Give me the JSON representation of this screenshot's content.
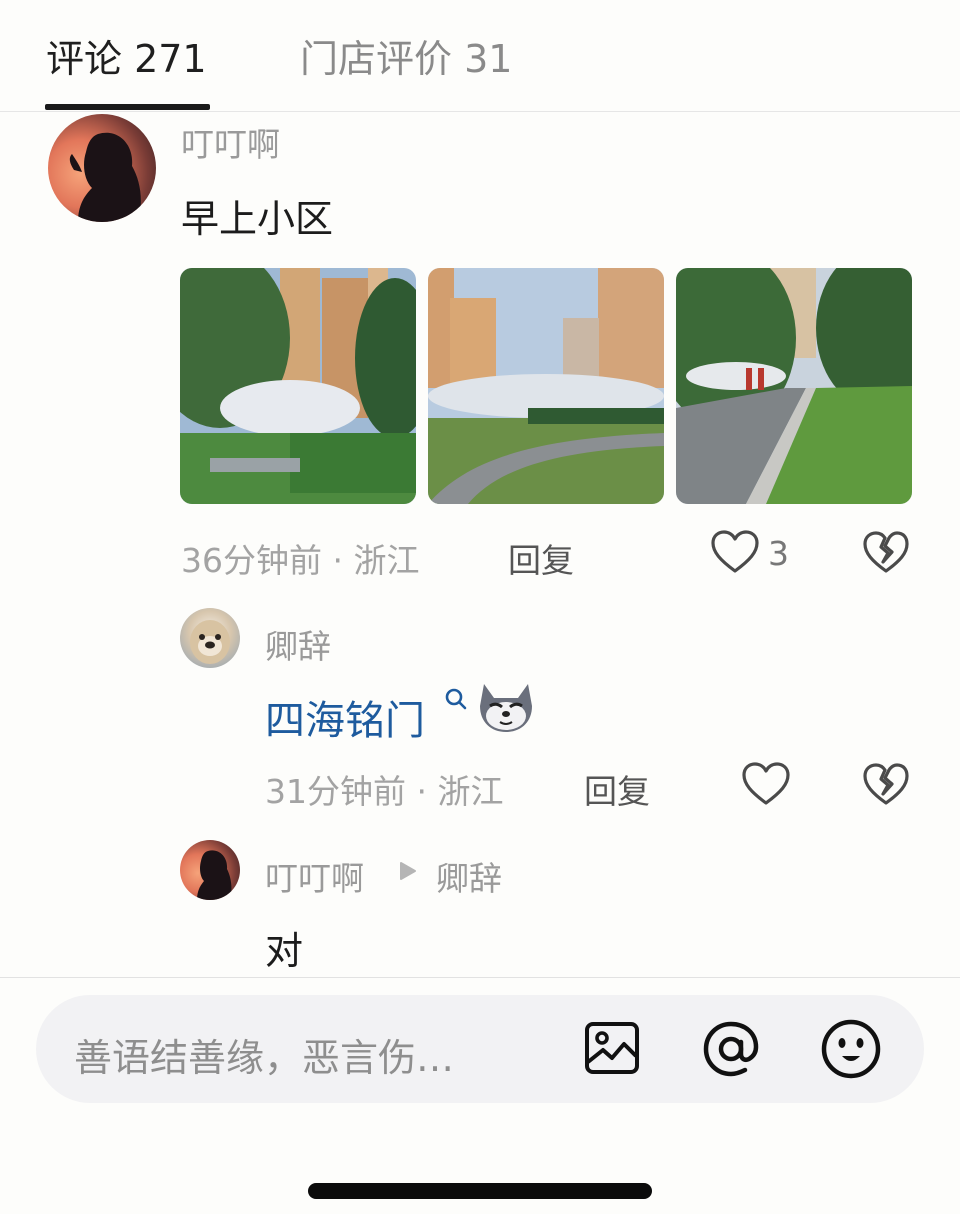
{
  "tabs": [
    {
      "label": "评论 271",
      "active": true
    },
    {
      "label": "门店评价 31",
      "active": false
    }
  ],
  "comment": {
    "username": "叮叮啊",
    "text": "早上小区",
    "time_location": "36分钟前 · 浙江",
    "reply_label": "回复",
    "like_count": "3",
    "photo_count": 3
  },
  "replies": [
    {
      "username": "卿辞",
      "text": "四海铭门",
      "time_location": "31分钟前 · 浙江",
      "reply_label": "回复"
    },
    {
      "username": "叮叮啊",
      "reply_to": "卿辞",
      "text": "对"
    }
  ],
  "input": {
    "placeholder": "善语结善缘，恶言伤…"
  },
  "icons": {
    "like": "heart-outline-icon",
    "dislike": "broken-heart-icon",
    "image": "image-icon",
    "mention": "at-icon",
    "emoji": "smiley-icon",
    "search": "search-icon",
    "arrow": "play-arrow-icon"
  },
  "colors": {
    "accent_link": "#1e5b9e",
    "tab_active": "#1f1f1f",
    "muted_text": "#9a9a9a"
  }
}
